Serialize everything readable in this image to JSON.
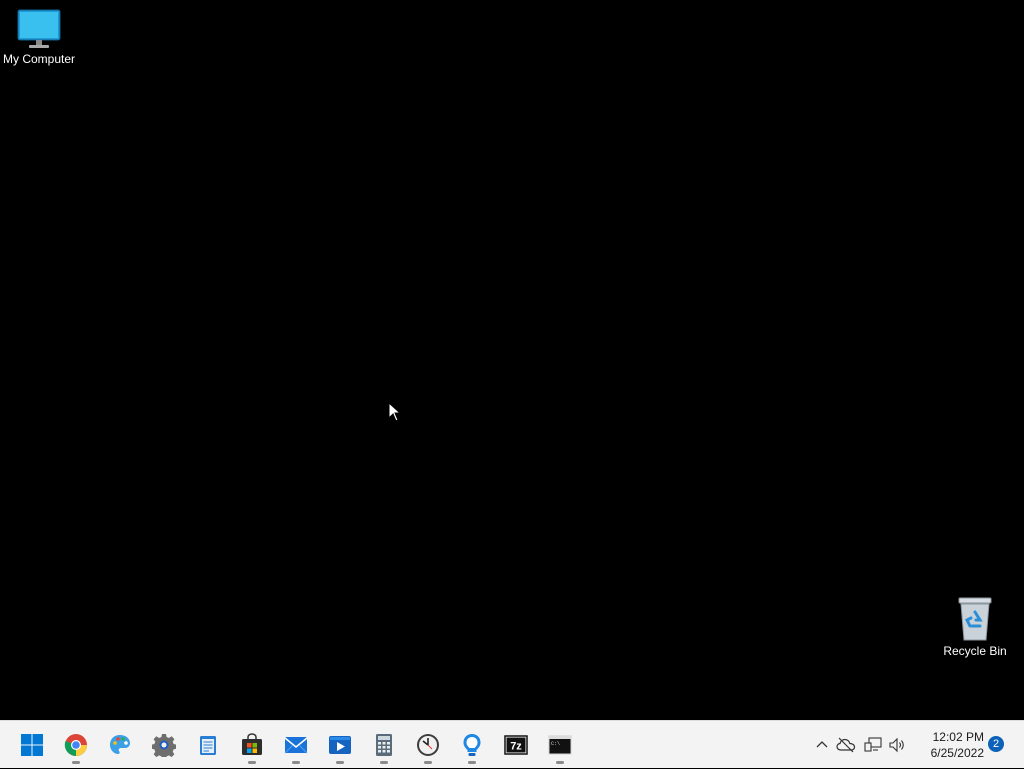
{
  "desktop": {
    "icons": [
      {
        "label": "My Computer",
        "icon": "monitor-icon"
      },
      {
        "label": "Recycle Bin",
        "icon": "recycle-bin-icon"
      }
    ]
  },
  "taskbar": {
    "apps": [
      {
        "name": "start",
        "icon": "windows-logo-icon",
        "running": false
      },
      {
        "name": "chrome",
        "icon": "chrome-icon",
        "running": true
      },
      {
        "name": "paint",
        "icon": "paint-palette-icon",
        "running": false
      },
      {
        "name": "settings",
        "icon": "gear-icon",
        "running": false
      },
      {
        "name": "notepad",
        "icon": "notepad-icon",
        "running": false
      },
      {
        "name": "store",
        "icon": "store-bag-icon",
        "running": true
      },
      {
        "name": "mail",
        "icon": "mail-icon",
        "running": true
      },
      {
        "name": "media-player",
        "icon": "media-player-icon",
        "running": true
      },
      {
        "name": "calculator",
        "icon": "calculator-icon",
        "running": true
      },
      {
        "name": "clock",
        "icon": "clock-icon",
        "running": true
      },
      {
        "name": "tips",
        "icon": "lightbulb-icon",
        "running": true
      },
      {
        "name": "7zip",
        "icon": "seven-zip-icon",
        "label": "7z",
        "running": false
      },
      {
        "name": "terminal",
        "icon": "terminal-icon",
        "label": "C:\\",
        "running": true
      }
    ],
    "tray": {
      "icons": [
        "chevron-up-icon",
        "onedrive-offline-icon",
        "network-icon",
        "volume-icon"
      ],
      "time": "12:02 PM",
      "date": "6/25/2022",
      "notification_count": "2"
    }
  },
  "colors": {
    "desktop_bg": "#000000",
    "taskbar_bg": "#f3f3f3",
    "accent": "#0b62b8"
  }
}
